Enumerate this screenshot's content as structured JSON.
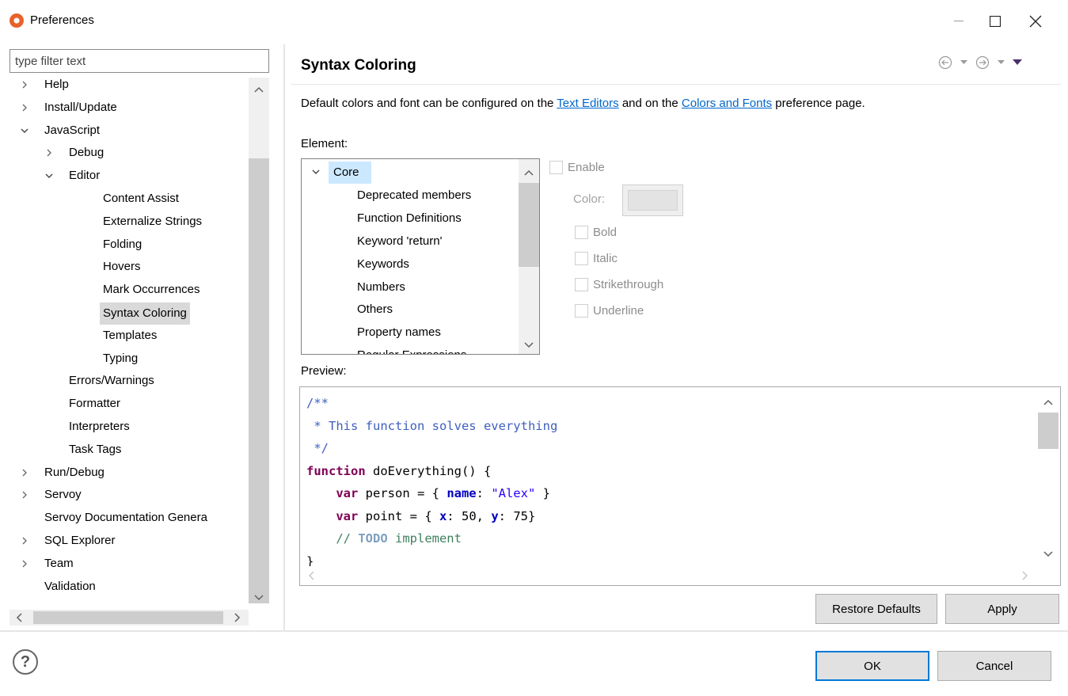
{
  "window": {
    "title": "Preferences",
    "min_glyph": "—",
    "max_glyph": "☐",
    "close_glyph": "✕"
  },
  "filter": {
    "placeholder": "type filter text",
    "value": ""
  },
  "tree": {
    "items": [
      {
        "label": "Help",
        "twisty": "›",
        "depth": 0,
        "selected": false
      },
      {
        "label": "Install/Update",
        "twisty": "›",
        "depth": 0,
        "selected": false
      },
      {
        "label": "JavaScript",
        "twisty": "⌄",
        "depth": 0,
        "selected": false
      },
      {
        "label": "Debug",
        "twisty": "›",
        "depth": 1,
        "selected": false
      },
      {
        "label": "Editor",
        "twisty": "⌄",
        "depth": 1,
        "selected": false
      },
      {
        "label": "Content Assist",
        "twisty": "",
        "depth": 2,
        "selected": false
      },
      {
        "label": "Externalize Strings",
        "twisty": "",
        "depth": 2,
        "selected": false
      },
      {
        "label": "Folding",
        "twisty": "",
        "depth": 2,
        "selected": false
      },
      {
        "label": "Hovers",
        "twisty": "",
        "depth": 2,
        "selected": false
      },
      {
        "label": "Mark Occurrences",
        "twisty": "",
        "depth": 2,
        "selected": false
      },
      {
        "label": "Syntax Coloring",
        "twisty": "",
        "depth": 2,
        "selected": true
      },
      {
        "label": "Templates",
        "twisty": "",
        "depth": 2,
        "selected": false
      },
      {
        "label": "Typing",
        "twisty": "",
        "depth": 2,
        "selected": false
      },
      {
        "label": "Errors/Warnings",
        "twisty": "",
        "depth": 1,
        "selected": false
      },
      {
        "label": "Formatter",
        "twisty": "",
        "depth": 1,
        "selected": false
      },
      {
        "label": "Interpreters",
        "twisty": "",
        "depth": 1,
        "selected": false
      },
      {
        "label": "Task Tags",
        "twisty": "",
        "depth": 1,
        "selected": false
      },
      {
        "label": "Run/Debug",
        "twisty": "›",
        "depth": 0,
        "selected": false
      },
      {
        "label": "Servoy",
        "twisty": "›",
        "depth": 0,
        "selected": false
      },
      {
        "label": "Servoy Documentation Genera",
        "twisty": "",
        "depth": 0,
        "selected": false
      },
      {
        "label": "SQL Explorer",
        "twisty": "›",
        "depth": 0,
        "selected": false
      },
      {
        "label": "Team",
        "twisty": "›",
        "depth": 0,
        "selected": false
      },
      {
        "label": "Validation",
        "twisty": "",
        "depth": 0,
        "selected": false
      }
    ]
  },
  "page": {
    "title": "Syntax Coloring",
    "description": {
      "part1": "Default colors and font can be configured on the ",
      "link1": "Text Editors",
      "part2": " and on the ",
      "link2": "Colors and Fonts",
      "part3": " preference page."
    },
    "element_label": "Element:",
    "elements": [
      {
        "label": "Core",
        "twisty": "⌄",
        "selected": true
      },
      {
        "label": "Deprecated members",
        "twisty": "",
        "selected": false
      },
      {
        "label": "Function Definitions",
        "twisty": "",
        "selected": false
      },
      {
        "label": "Keyword 'return'",
        "twisty": "",
        "selected": false
      },
      {
        "label": "Keywords",
        "twisty": "",
        "selected": false
      },
      {
        "label": "Numbers",
        "twisty": "",
        "selected": false
      },
      {
        "label": "Others",
        "twisty": "",
        "selected": false
      },
      {
        "label": "Property names",
        "twisty": "",
        "selected": false
      },
      {
        "label": "Regular Expressions",
        "twisty": "",
        "selected": false
      }
    ],
    "options": {
      "enable": "Enable",
      "color": "Color:",
      "bold": "Bold",
      "italic": "Italic",
      "strikethrough": "Strikethrough",
      "underline": "Underline"
    },
    "preview_label": "Preview:",
    "preview_lines": [
      [
        {
          "t": "/**",
          "c": "doc"
        }
      ],
      [
        {
          "t": " * This function solves everything",
          "c": "doc"
        }
      ],
      [
        {
          "t": " */",
          "c": "doc"
        }
      ],
      [
        {
          "t": "function",
          "c": "kw"
        },
        {
          "t": " doEverything() {",
          "c": "plain"
        }
      ],
      [
        {
          "t": "    ",
          "c": "plain"
        },
        {
          "t": "var",
          "c": "kw"
        },
        {
          "t": " person = { ",
          "c": "plain"
        },
        {
          "t": "name",
          "c": "prop"
        },
        {
          "t": ": ",
          "c": "plain"
        },
        {
          "t": "\"Alex\"",
          "c": "str"
        },
        {
          "t": " }",
          "c": "plain"
        }
      ],
      [
        {
          "t": "    ",
          "c": "plain"
        },
        {
          "t": "var",
          "c": "kw"
        },
        {
          "t": " point = { ",
          "c": "plain"
        },
        {
          "t": "x",
          "c": "prop"
        },
        {
          "t": ": 50, ",
          "c": "plain"
        },
        {
          "t": "y",
          "c": "prop"
        },
        {
          "t": ": 75}",
          "c": "plain"
        }
      ],
      [
        {
          "t": "    // ",
          "c": "cmt"
        },
        {
          "t": "TODO",
          "c": "todo"
        },
        {
          "t": " implement",
          "c": "cmt"
        }
      ],
      [
        {
          "t": "}",
          "c": "plain"
        }
      ]
    ]
  },
  "buttons": {
    "restore_defaults": "Restore Defaults",
    "apply": "Apply",
    "ok": "OK",
    "cancel": "Cancel",
    "help": "?"
  },
  "icons": {
    "back": "⊝",
    "forward": "⊝",
    "dropdown": "▾",
    "view_menu": "▼"
  }
}
